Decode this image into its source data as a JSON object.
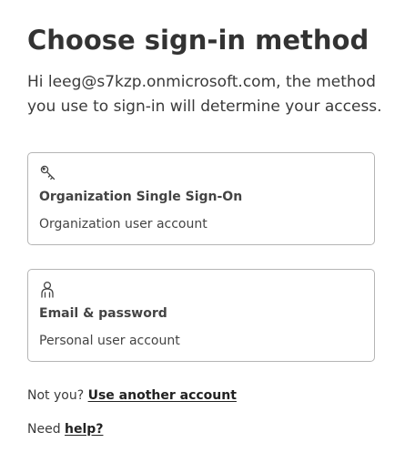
{
  "header": {
    "title": "Choose sign-in method",
    "intro_prefix": "Hi ",
    "email": "leeg@s7kzp.onmicrosoft.com",
    "intro_suffix": ", the method you use to sign-in will determine your access."
  },
  "methods": [
    {
      "icon": "key-icon",
      "title": "Organization Single Sign-On",
      "subtitle": "Organization user account"
    },
    {
      "icon": "user-icon",
      "title": "Email & password",
      "subtitle": "Personal user account"
    }
  ],
  "footer": {
    "not_you_text": "Not you?",
    "use_another_account": "Use another account",
    "need_text": "Need",
    "help_link": "help?"
  },
  "colors": {
    "text": "#333333",
    "border": "#b5b5b5",
    "background": "#ffffff"
  }
}
